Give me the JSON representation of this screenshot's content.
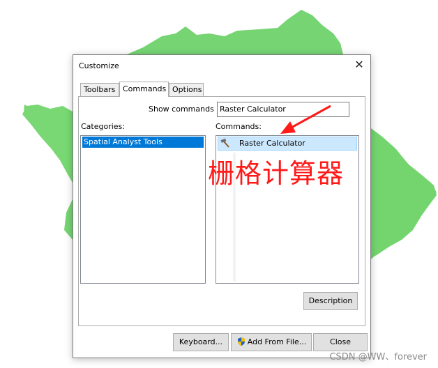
{
  "dialog": {
    "title": "Customize",
    "close_glyph": "✕"
  },
  "tabs": [
    {
      "label": "Toolbars"
    },
    {
      "label": "Commands"
    },
    {
      "label": "Options"
    }
  ],
  "active_tab": "Commands",
  "show_commands": {
    "label": "Show commands",
    "value": "Raster Calculator"
  },
  "categories": {
    "label": "Categories:",
    "items": [
      "Spatial Analyst Tools"
    ]
  },
  "commands": {
    "label": "Commands:",
    "items": [
      {
        "label": "Raster Calculator",
        "icon": "hammer-icon"
      }
    ]
  },
  "buttons": {
    "description": "Description",
    "keyboard": "Keyboard...",
    "add_from_file": "Add From File...",
    "close": "Close"
  },
  "annotation": {
    "text": "栅格计算器",
    "color": "#ff1a1a"
  },
  "watermark": "CSDN @WW、forever",
  "colors": {
    "selection_blue": "#0078d7",
    "selection_light": "#cce8ff",
    "map_green": "#6fd26b"
  }
}
